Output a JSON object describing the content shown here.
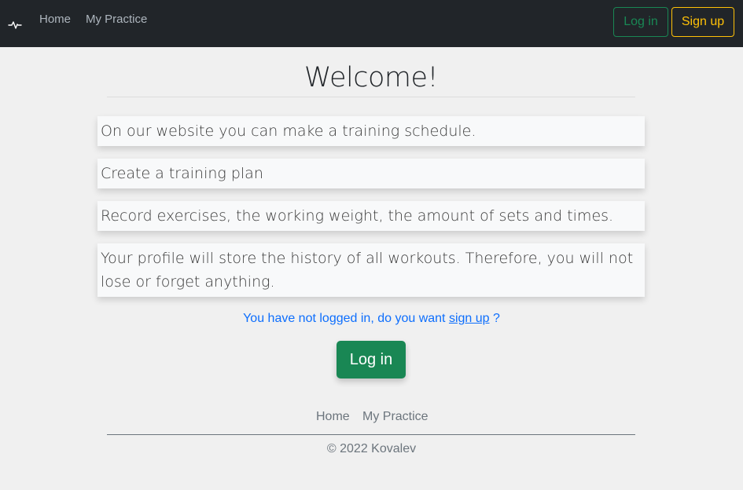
{
  "navbar": {
    "brand_icon": "activity-icon",
    "links": [
      {
        "label": "Home"
      },
      {
        "label": "My Practice"
      }
    ],
    "login_label": "Log in",
    "signup_label": "Sign up"
  },
  "main": {
    "title": "Welcome!",
    "features": [
      "On our website you can make a training schedule.",
      "Create a training plan",
      "Record exercises, the working weight, the amount of sets and times.",
      "Your profile will store the history of all workouts. Therefore, you will not lose or forget anything."
    ],
    "notice_prefix": "You have not logged in, do you want",
    "notice_link": "sign up",
    "notice_suffix": "?",
    "login_button": "Log in"
  },
  "footer": {
    "links": [
      {
        "label": "Home"
      },
      {
        "label": "My Practice"
      }
    ],
    "copyright": "© 2022 Kovalev"
  },
  "colors": {
    "navbar_bg": "#212529",
    "success": "#198754",
    "warning": "#ffc107",
    "link": "#0d6efd"
  }
}
